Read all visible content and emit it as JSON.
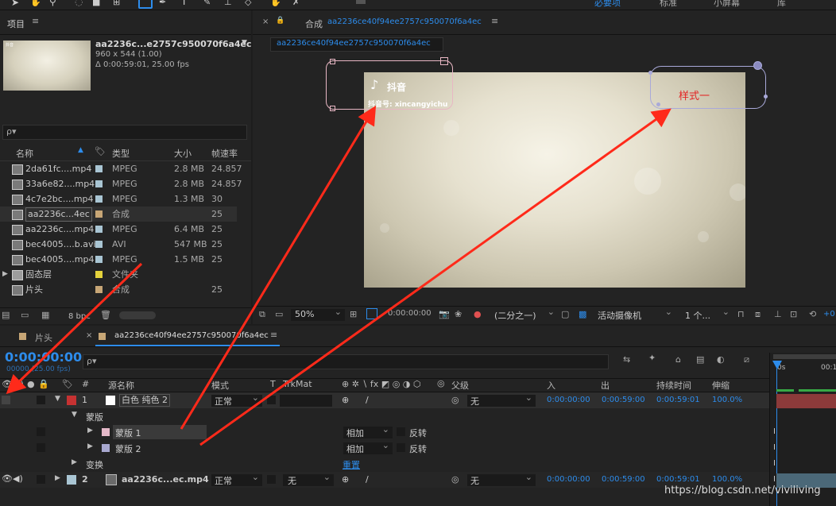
{
  "topbar": {
    "workspace_items": [
      "必要项",
      "标准",
      "小屏幕",
      "库"
    ]
  },
  "project_panel": {
    "title": "项目",
    "menu_icon": "hamburger-icon",
    "thumbnail": {
      "name": "aa2236c...e2757c950070f6a4ec",
      "dims": "960 x 544 (1.00)",
      "duration": "Δ 0:00:59:01, 25.00 fps",
      "logo_text": "抖音"
    },
    "search_placeholder": "ρ▾",
    "columns": [
      "名称",
      "类型",
      "大小",
      "帧速率"
    ],
    "items": [
      {
        "name": "2da61fc....mp4",
        "type": "MPEG",
        "size": "2.8 MB",
        "fps": "24.857",
        "color": "#a9c5d3"
      },
      {
        "name": "33a6e82....mp4",
        "type": "MPEG",
        "size": "2.8 MB",
        "fps": "24.857",
        "color": "#a9c5d3"
      },
      {
        "name": "4c7e2bc....mp4",
        "type": "MPEG",
        "size": "1.3 MB",
        "fps": "30",
        "color": "#a9c5d3"
      },
      {
        "name": "aa2236c...4ec",
        "type": "合成",
        "size": "",
        "fps": "25",
        "color": "#c7a676"
      },
      {
        "name": "aa2236c....mp4",
        "type": "MPEG",
        "size": "6.4 MB",
        "fps": "25",
        "color": "#a9c5d3"
      },
      {
        "name": "bec4005....b.avi",
        "type": "AVI",
        "size": "547 MB",
        "fps": "25",
        "color": "#a9c5d3"
      },
      {
        "name": "bec4005....mp4",
        "type": "MPEG",
        "size": "1.5 MB",
        "fps": "25",
        "color": "#a9c5d3"
      },
      {
        "name": "固态层",
        "type": "文件夹",
        "size": "",
        "fps": "",
        "color": "#e4d23c"
      },
      {
        "name": "片头",
        "type": "合成",
        "size": "",
        "fps": "25",
        "color": "#c7a676"
      }
    ],
    "bpc": "8 bpc"
  },
  "composition_viewer": {
    "tab_label": "合成",
    "tab_name": "aa2236ce40f94ee2757c950070f6a4ec",
    "breadcrumb": "aa2236ce40f94ee2757c950070f6a4ec",
    "overlay_logo": "抖音",
    "overlay_account": "抖音号: xincangyichu",
    "overlay_style": "样式一",
    "toolbar": {
      "zoom": "50%",
      "timecode": "0:00:00:00",
      "resolution": "(二分之一)",
      "camera": "活动摄像机",
      "views": "1 个...",
      "exposure": "+0"
    }
  },
  "timeline": {
    "tabs": [
      {
        "label": "片头"
      },
      {
        "label": "aa2236ce40f94ee2757c950070f6a4ec"
      }
    ],
    "current_time": "0:00:00:00",
    "current_time_sub": "00000 (25.00 fps)",
    "search_placeholder": "ρ▾",
    "columns": {
      "num": "#",
      "source": "源名称",
      "mode": "模式",
      "t": "T",
      "trkmat": "TrkMat",
      "parent": "父级",
      "in": "入",
      "out": "出",
      "duration": "持续时间",
      "stretch": "伸缩"
    },
    "ruler": [
      "0s",
      "00:1"
    ],
    "layers": [
      {
        "num": "1",
        "name": "白色 纯色 2",
        "mode": "正常",
        "parent": "无",
        "in": "0:00:00:00",
        "out": "0:00:59:00",
        "duration": "0:00:59:01",
        "stretch": "100.0%",
        "label_color": "#c63232"
      },
      {
        "num": "2",
        "name": "aa2236c...ec.mp4",
        "mode": "正常",
        "trkmat": "无",
        "parent": "无",
        "in": "0:00:00:00",
        "out": "0:00:59:00",
        "duration": "0:00:59:01",
        "stretch": "100.0%",
        "label_color": "#a9c5d3"
      }
    ],
    "masks_group": "蒙版",
    "masks": [
      {
        "name": "蒙版 1",
        "mode": "相加",
        "invert": "反转",
        "color": "#e4b8c8"
      },
      {
        "name": "蒙版 2",
        "mode": "相加",
        "invert": "反转",
        "color": "#a8a8d0"
      }
    ],
    "transform": "变换",
    "reset": "重置"
  },
  "watermark": "https://blog.csdn.net/viviliving",
  "accent_colors": {
    "blue": "#2d8ceb",
    "annotation_arrow": "#ff2a1a"
  }
}
